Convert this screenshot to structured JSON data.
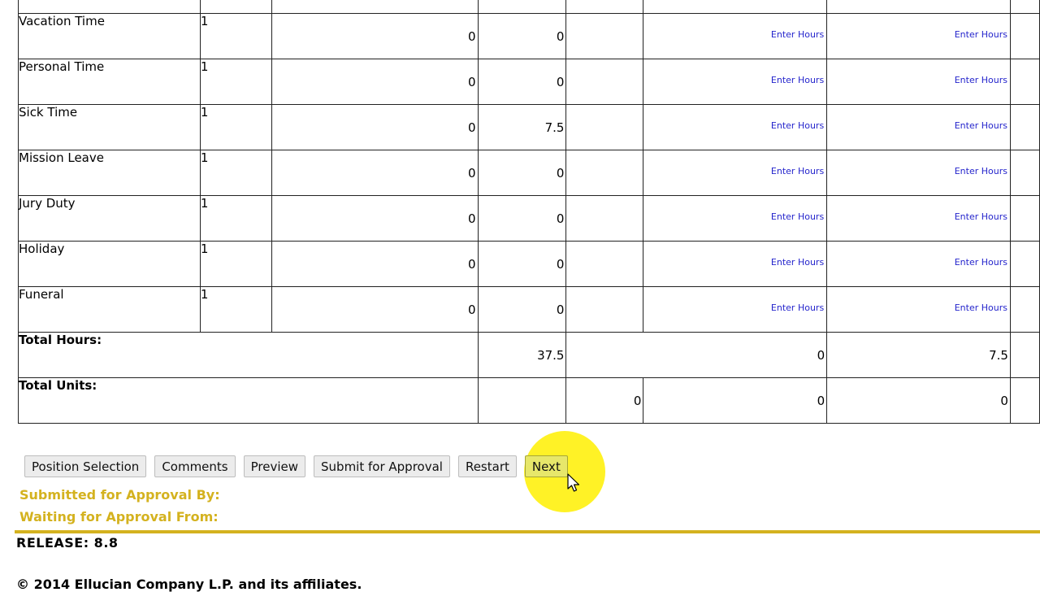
{
  "rows": [
    {
      "label": "Vacation Time",
      "unit": "1",
      "v1": "0",
      "v2": "0",
      "link1": "Enter Hours",
      "link2": "Enter Hours"
    },
    {
      "label": "Personal Time",
      "unit": "1",
      "v1": "0",
      "v2": "0",
      "link1": "Enter Hours",
      "link2": "Enter Hours"
    },
    {
      "label": "Sick Time",
      "unit": "1",
      "v1": "0",
      "v2": "7.5",
      "link1": "Enter Hours",
      "link2": "Enter Hours"
    },
    {
      "label": "Mission Leave",
      "unit": "1",
      "v1": "0",
      "v2": "0",
      "link1": "Enter Hours",
      "link2": "Enter Hours"
    },
    {
      "label": "Jury Duty",
      "unit": "1",
      "v1": "0",
      "v2": "0",
      "link1": "Enter Hours",
      "link2": "Enter Hours"
    },
    {
      "label": "Holiday",
      "unit": "1",
      "v1": "0",
      "v2": "0",
      "link1": "Enter Hours",
      "link2": "Enter Hours"
    },
    {
      "label": "Funeral",
      "unit": "1",
      "v1": "0",
      "v2": "0",
      "link1": "Enter Hours",
      "link2": "Enter Hours"
    }
  ],
  "totals": {
    "hours_label": "Total Hours:",
    "hours": [
      "37.5",
      "0",
      "7.5"
    ],
    "units_label": "Total Units:",
    "units": [
      "0",
      "0",
      "0"
    ]
  },
  "buttons": {
    "position_selection": "Position Selection",
    "comments": "Comments",
    "preview": "Preview",
    "submit_for_approval": "Submit for Approval",
    "restart": "Restart",
    "next": "Next"
  },
  "status": {
    "submitted_by": "Submitted for Approval By:",
    "waiting_from": "Waiting for Approval From:"
  },
  "footer": {
    "release": "RELEASE: 8.8",
    "copyright": "© 2014 Ellucian Company L.P. and its affiliates."
  },
  "colors": {
    "accent_gold": "#d4b21f",
    "link_blue": "#2424cc",
    "highlight_yellow": "#fff000"
  }
}
